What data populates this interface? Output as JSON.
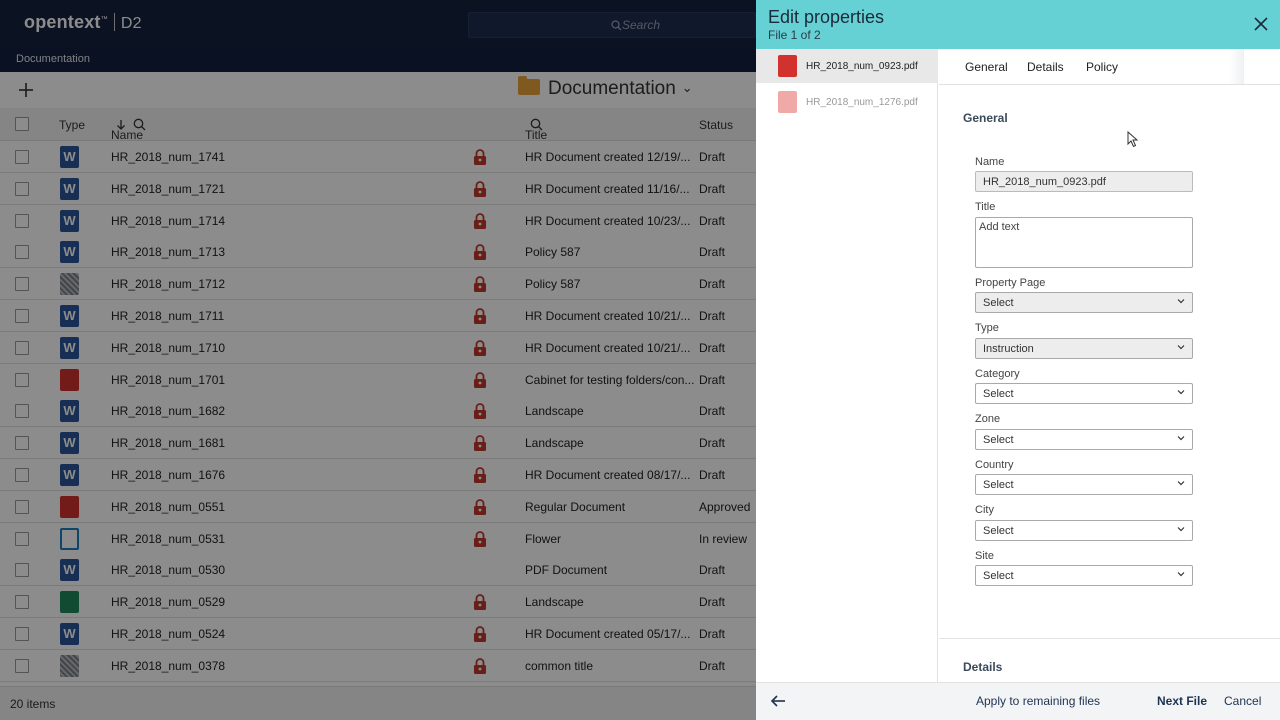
{
  "app": {
    "logo_brand": "opentext",
    "logo_tm": "™",
    "logo_product": "D2",
    "search_placeholder": "Search",
    "breadcrumb": "Documentation",
    "folder_title": "Documentation"
  },
  "table": {
    "headers": {
      "type": "Type",
      "name": "Name",
      "title": "Title",
      "status": "Status"
    },
    "rows": [
      {
        "icon": "word-icon",
        "name": "HR_2018_num_1741",
        "locked": true,
        "title": "HR Document created 12/19/...",
        "status": "Draft"
      },
      {
        "icon": "word-icon",
        "name": "HR_2018_num_1721",
        "locked": true,
        "title": "HR Document created 11/16/...",
        "status": "Draft"
      },
      {
        "icon": "word-icon",
        "name": "HR_2018_num_1714",
        "locked": true,
        "title": "HR Document created 10/23/...",
        "status": "Draft"
      },
      {
        "icon": "word-icon",
        "name": "HR_2018_num_1713",
        "locked": true,
        "title": "Policy 587",
        "status": "Draft"
      },
      {
        "icon": "generic-file-icon",
        "name": "HR_2018_num_1712",
        "locked": true,
        "title": "Policy 587",
        "status": "Draft"
      },
      {
        "icon": "word-icon",
        "name": "HR_2018_num_1711",
        "locked": true,
        "title": "HR Document created 10/21/...",
        "status": "Draft"
      },
      {
        "icon": "word-icon",
        "name": "HR_2018_num_1710",
        "locked": true,
        "title": "HR Document created 10/21/...",
        "status": "Draft"
      },
      {
        "icon": "pdf-icon",
        "name": "HR_2018_num_1701",
        "locked": true,
        "title": "Cabinet for testing folders/con...",
        "status": "Draft"
      },
      {
        "icon": "word-icon",
        "name": "HR_2018_num_1682",
        "locked": true,
        "title": "Landscape",
        "status": "Draft"
      },
      {
        "icon": "word-icon",
        "name": "HR_2018_num_1681",
        "locked": true,
        "title": "Landscape",
        "status": "Draft"
      },
      {
        "icon": "word-icon",
        "name": "HR_2018_num_1676",
        "locked": true,
        "title": "HR Document created 08/17/...",
        "status": "Draft"
      },
      {
        "icon": "pdf-icon",
        "name": "HR_2018_num_0551",
        "locked": true,
        "title": "Regular Document",
        "status": "Approved"
      },
      {
        "icon": "visio-icon",
        "name": "HR_2018_num_0531",
        "locked": true,
        "title": "Flower",
        "status": "In review"
      },
      {
        "icon": "word-icon",
        "name": "HR_2018_num_0530",
        "locked": false,
        "title": "PDF Document",
        "status": "Draft"
      },
      {
        "icon": "image-icon",
        "name": "HR_2018_num_0529",
        "locked": true,
        "title": "Landscape",
        "status": "Draft"
      },
      {
        "icon": "word-icon",
        "name": "HR_2018_num_0524",
        "locked": true,
        "title": "HR Document created 05/17/...",
        "status": "Draft"
      },
      {
        "icon": "generic-file-icon",
        "name": "HR_2018_num_0378",
        "locked": true,
        "title": "common title",
        "status": "Draft"
      }
    ],
    "item_count": "20 items"
  },
  "panel": {
    "title": "Edit properties",
    "subtitle": "File 1 of 2",
    "files": [
      {
        "name": "HR_2018_num_0923.pdf",
        "active": true
      },
      {
        "name": "HR_2018_num_1276.pdf",
        "active": false
      }
    ],
    "tabs": [
      "General",
      "Details",
      "Policy"
    ],
    "section_general": "General",
    "section_details": "Details",
    "fields": {
      "name_label": "Name",
      "name_value": "HR_2018_num_0923.pdf",
      "title_label": "Title",
      "title_placeholder": "Add text",
      "property_page_label": "Property Page",
      "property_page_value": "Select",
      "type_label": "Type",
      "type_value": "Instruction",
      "category_label": "Category",
      "category_value": "Select",
      "zone_label": "Zone",
      "zone_value": "Select",
      "country_label": "Country",
      "country_value": "Select",
      "city_label": "City",
      "city_value": "Select",
      "site_label": "Site",
      "site_value": "Select"
    },
    "footer": {
      "apply": "Apply to remaining files",
      "next": "Next File",
      "cancel": "Cancel"
    }
  },
  "colors": {
    "panel_header": "#66d1d5",
    "topbar": "#14213f",
    "word": "#2b579a",
    "pdf": "#d2322d",
    "lock": "#c0392b"
  }
}
